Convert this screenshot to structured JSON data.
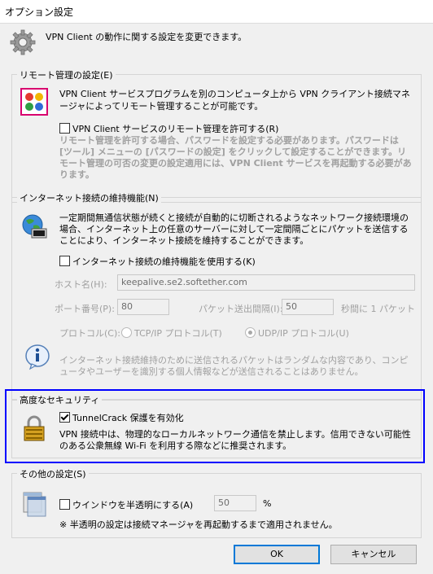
{
  "window": {
    "title": "オプション設定"
  },
  "header": {
    "text": "VPN Client の動作に関する設定を変更できます。"
  },
  "remote": {
    "legend": "リモート管理の設定(E)",
    "description": "VPN Client サービスプログラムを別のコンピュータ上から VPN クライアント接続マネージャによってリモート管理することが可能です。",
    "checkbox_label": "VPN Client サービスのリモート管理を許可する(R)",
    "checked": false,
    "note": "リモート管理を許可する場合、パスワードを設定する必要があります。パスワードは [ツール] メニューの [パスワードの設定] をクリックして設定することができます。リモート管理の可否の変更の設定適用には、VPN Client サービスを再起動する必要があります。"
  },
  "keepalive": {
    "legend": "インターネット接続の維持機能(N)",
    "description": "一定期間無通信状態が続くと接続が自動的に切断されるようなネットワーク接続環境の場合、インターネット上の任意のサーバーに対して一定間隔ごとにパケットを送信することにより、インターネット接続を維持することができます。",
    "checkbox_label": "インターネット接続の維持機能を使用する(K)",
    "checked": false,
    "host_label": "ホスト名(H):",
    "host_value": "keepalive.se2.softether.com",
    "port_label": "ポート番号(P):",
    "port_value": "80",
    "interval_label": "パケット送出間隔(I):",
    "interval_value": "50",
    "interval_unit": "秒間に 1 パケット",
    "protocol_label": "プロトコル(C):",
    "tcp_label": "TCP/IP プロトコル(T)",
    "udp_label": "UDP/IP プロトコル(U)",
    "selected_protocol": "UDP",
    "info": "インターネット接続維持のために送信されるパケットはランダムな内容であり、コンピュータやユーザーを識別する個人情報などが送信されることはありません。"
  },
  "security": {
    "legend": "高度なセキュリティ",
    "checkbox_label": "TunnelCrack 保護を有効化",
    "checked": true,
    "description": "VPN 接続中は、物理的なローカルネットワーク通信を禁止します。信用できない可能性のある公衆無線 Wi-Fi を利用する際などに推奨されます。",
    "highlight_color": "#0000ff"
  },
  "other": {
    "legend": "その他の設定(S)",
    "checkbox_label": "ウインドウを半透明にする(A)",
    "checked": false,
    "percent_value": "50",
    "percent_unit": "%",
    "note": "※ 半透明の設定は接続マネージャを再起動するまで適用されません。"
  },
  "buttons": {
    "ok": "OK",
    "cancel": "キャンセル"
  }
}
